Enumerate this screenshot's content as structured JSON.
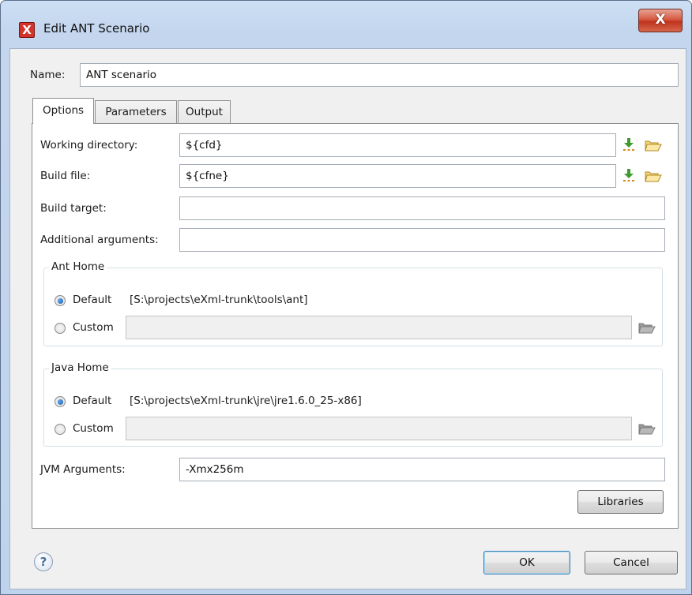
{
  "window": {
    "title": "Edit ANT Scenario",
    "close_glyph": "X"
  },
  "name_row": {
    "label": "Name:",
    "value": "ANT scenario"
  },
  "tabs": [
    {
      "label": "Options",
      "active": true
    },
    {
      "label": "Parameters",
      "active": false
    },
    {
      "label": "Output",
      "active": false
    }
  ],
  "options": {
    "working_directory": {
      "label": "Working directory:",
      "value": "${cfd}"
    },
    "build_file": {
      "label": "Build file:",
      "value": "${cfne}"
    },
    "build_target": {
      "label": "Build target:",
      "value": ""
    },
    "additional_arguments": {
      "label": "Additional arguments:",
      "value": ""
    },
    "ant_home": {
      "legend": "Ant Home",
      "default_label": "Default",
      "default_path": "[S:\\projects\\eXml-trunk\\tools\\ant]",
      "custom_label": "Custom",
      "custom_value": "",
      "selected": "default"
    },
    "java_home": {
      "legend": "Java Home",
      "default_label": "Default",
      "default_path": "[S:\\projects\\eXml-trunk\\jre\\jre1.6.0_25-x86]",
      "custom_label": "Custom",
      "custom_value": "",
      "selected": "default"
    },
    "jvm_arguments": {
      "label": "JVM Arguments:",
      "value": "-Xmx256m"
    },
    "libraries_button": "Libraries"
  },
  "footer": {
    "help_glyph": "?",
    "ok_label": "OK",
    "cancel_label": "Cancel"
  },
  "colors": {
    "title_gradient": "#cddff4",
    "close_button": "#c0331d",
    "default_button_border": "#3c7fb1",
    "radio_dot": "#1b5fb4"
  }
}
